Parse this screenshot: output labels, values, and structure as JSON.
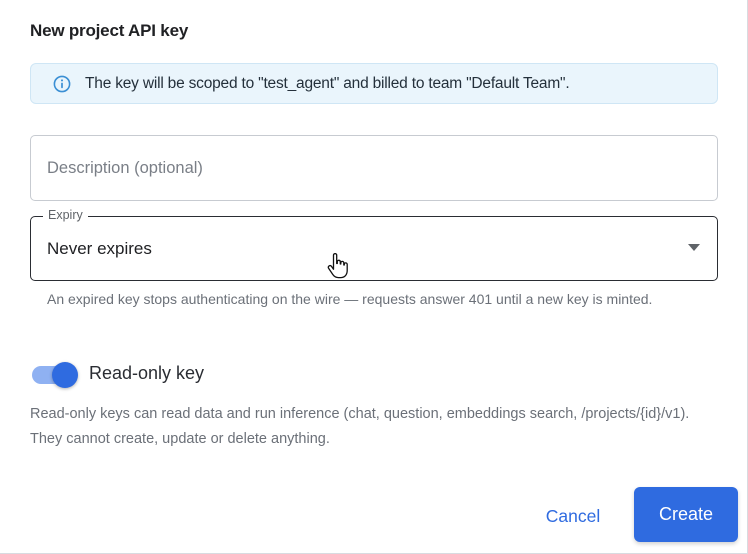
{
  "dialog": {
    "title": "New project API key"
  },
  "info_banner": {
    "icon": "info-icon",
    "text": "The key will be scoped to \"test_agent\" and billed to team \"Default Team\"."
  },
  "description_field": {
    "value": "",
    "placeholder": "Description (optional)"
  },
  "expiry_field": {
    "label": "Expiry",
    "selected": "Never expires",
    "icon": "caret-down-icon",
    "helper": "An expired key stops authenticating on the wire — requests answer 401 until a new key is minted."
  },
  "read_only_toggle": {
    "label": "Read-only key",
    "checked": true,
    "helper": "Read-only keys can read data and run inference (chat, question, embeddings search, /projects/{id}/v1). They cannot create, update or delete anything."
  },
  "actions": {
    "cancel_label": "Cancel",
    "create_label": "Create"
  },
  "colors": {
    "accent": "#2f6be0",
    "info_bg": "#eaf5fc",
    "info_icon": "#3b8fd4"
  }
}
